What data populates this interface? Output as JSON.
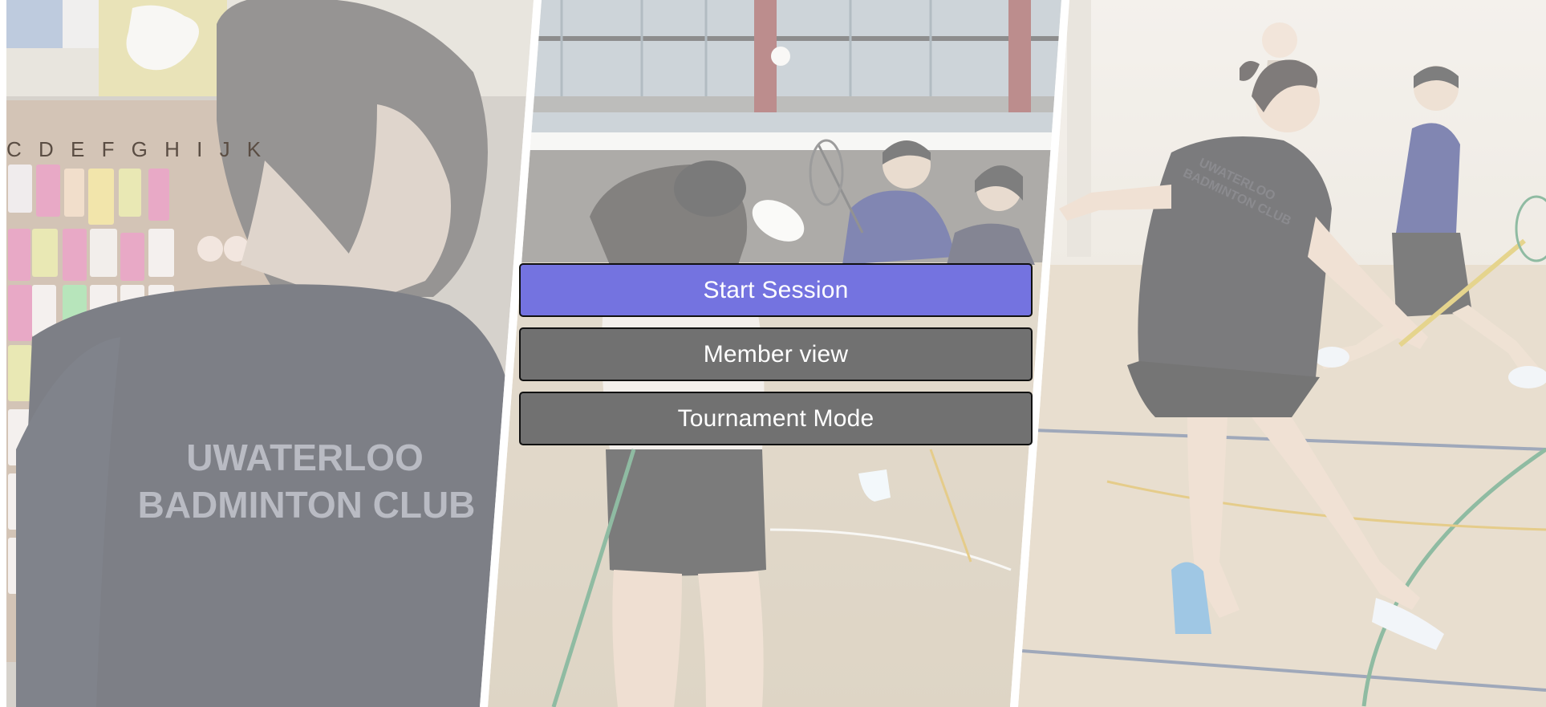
{
  "menu": {
    "start_session_label": "Start Session",
    "member_view_label": "Member view",
    "tournament_mode_label": "Tournament Mode"
  },
  "background": {
    "shirt_text_line1": "UWATERLOO",
    "shirt_text_line2": "BADMINTON CLUB",
    "shirt_back_text_line1": "UWATERLOO",
    "shirt_back_text_line2": "BADMINTON CLUB",
    "board_letters": "C D E F G H I J K"
  },
  "colors": {
    "start_button": "#7473e0",
    "secondary_button": "#717171",
    "panel_divider": "#ffffff"
  }
}
